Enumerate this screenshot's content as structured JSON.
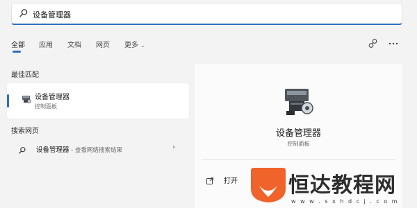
{
  "search": {
    "value": "设备管理器"
  },
  "tabs": [
    {
      "label": "全部",
      "active": true
    },
    {
      "label": "应用"
    },
    {
      "label": "文档"
    },
    {
      "label": "网页"
    },
    {
      "label": "更多"
    }
  ],
  "best_match": {
    "heading": "最佳匹配",
    "title": "设备管理器",
    "subtitle": "控制面板"
  },
  "web_search": {
    "heading": "搜索网页",
    "result_title": "设备管理器",
    "result_suffix": " - 查看网络搜索结果"
  },
  "detail": {
    "name": "设备管理器",
    "category": "控制面板",
    "open_label": "打开"
  },
  "watermark": {
    "text": "恒达教程网",
    "url": "w w w . s x h d c j . c o m"
  },
  "colors": {
    "accent": "#2f6fbe",
    "brand_orange": "#f0632a"
  }
}
